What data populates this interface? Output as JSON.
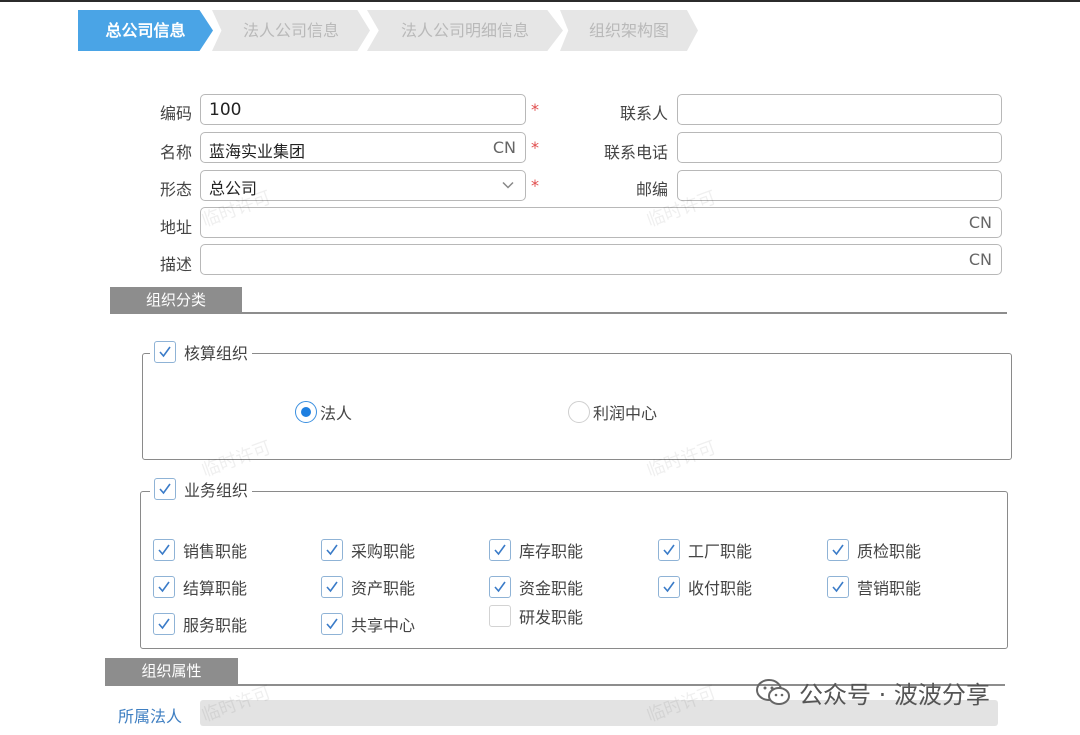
{
  "steps": [
    {
      "label": "总公司信息",
      "active": true
    },
    {
      "label": "法人公司信息",
      "active": false
    },
    {
      "label": "法人公司明细信息",
      "active": false
    },
    {
      "label": "组织架构图",
      "active": false
    }
  ],
  "form": {
    "code_label": "编码",
    "code_value": "100",
    "name_label": "名称",
    "name_value": "蓝海实业集团",
    "name_lang": "CN",
    "form_label": "形态",
    "form_value": "总公司",
    "contact_label": "联系人",
    "contact_value": "",
    "phone_label": "联系电话",
    "phone_value": "",
    "zip_label": "邮编",
    "zip_value": "",
    "address_label": "地址",
    "address_value": "",
    "address_lang": "CN",
    "desc_label": "描述",
    "desc_value": "",
    "desc_lang": "CN",
    "required_mark": "*"
  },
  "org_category": {
    "title": "组织分类",
    "accounting": {
      "label": "核算组织",
      "checked": true,
      "radio_legal": "法人",
      "radio_profit": "利润中心",
      "selected": "法人"
    },
    "business": {
      "label": "业务组织",
      "checked": true,
      "functions": [
        {
          "label": "销售职能",
          "checked": true
        },
        {
          "label": "采购职能",
          "checked": true
        },
        {
          "label": "库存职能",
          "checked": true
        },
        {
          "label": "工厂职能",
          "checked": true
        },
        {
          "label": "质检职能",
          "checked": true
        },
        {
          "label": "结算职能",
          "checked": true
        },
        {
          "label": "资产职能",
          "checked": true
        },
        {
          "label": "资金职能",
          "checked": true
        },
        {
          "label": "收付职能",
          "checked": true
        },
        {
          "label": "营销职能",
          "checked": true
        },
        {
          "label": "服务职能",
          "checked": true
        },
        {
          "label": "共享中心",
          "checked": true
        },
        {
          "label": "研发职能",
          "checked": false
        }
      ]
    }
  },
  "org_attr": {
    "title": "组织属性",
    "legal_label": "所属法人",
    "legal_value": ""
  },
  "watermark": "临时许可",
  "brand": {
    "text": "公众号 · 波波分享"
  },
  "colors": {
    "accent": "#4aa4e6",
    "checkbox_border": "#8fb3d6",
    "required": "#e04b4b",
    "section": "#8d8d8d"
  }
}
